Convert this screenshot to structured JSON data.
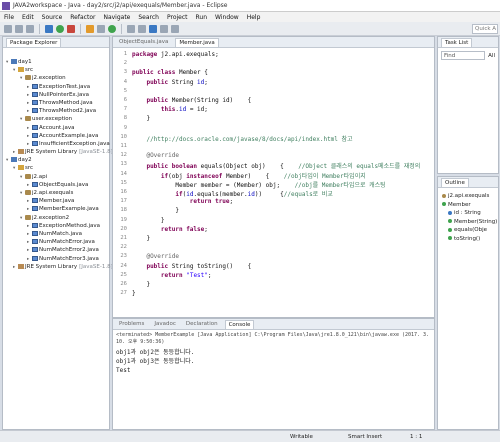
{
  "window": {
    "title": "JAVA2workspace - Java - day2/src/j2/api/exequals/Member.java - Eclipse"
  },
  "menu": [
    "File",
    "Edit",
    "Source",
    "Refactor",
    "Navigate",
    "Search",
    "Project",
    "Run",
    "Window",
    "Help"
  ],
  "quick_access": "Quick A",
  "package_explorer": {
    "tab": "Package Explorer",
    "items": [
      {
        "label": "day1",
        "kind": "proj",
        "indent": 0,
        "tri": "▾"
      },
      {
        "label": "src",
        "kind": "src",
        "indent": 1,
        "tri": "▾"
      },
      {
        "label": "j2.exception",
        "kind": "pkg",
        "indent": 2,
        "tri": "▾"
      },
      {
        "label": "ExceptionTest.java",
        "kind": "java",
        "indent": 3,
        "tri": "▸"
      },
      {
        "label": "NullPointerEx.java",
        "kind": "java",
        "indent": 3,
        "tri": "▸"
      },
      {
        "label": "ThrowsMethod.java",
        "kind": "java",
        "indent": 3,
        "tri": "▸"
      },
      {
        "label": "ThrowsMethod2.java",
        "kind": "java",
        "indent": 3,
        "tri": "▸"
      },
      {
        "label": "user.exception",
        "kind": "pkg",
        "indent": 2,
        "tri": "▾"
      },
      {
        "label": "Account.java",
        "kind": "java",
        "indent": 3,
        "tri": "▸"
      },
      {
        "label": "AccountExample.java",
        "kind": "java",
        "indent": 3,
        "tri": "▸"
      },
      {
        "label": "InsufficientException.java",
        "kind": "java",
        "indent": 3,
        "tri": "▸"
      },
      {
        "label": "JRE System Library",
        "suffix": "[JavaSE-1.8]",
        "kind": "lib",
        "indent": 1,
        "tri": "▸"
      },
      {
        "label": "day2",
        "kind": "proj",
        "indent": 0,
        "tri": "▾"
      },
      {
        "label": "src",
        "kind": "src",
        "indent": 1,
        "tri": "▾"
      },
      {
        "label": "j2.api",
        "kind": "pkg",
        "indent": 2,
        "tri": "▾"
      },
      {
        "label": "ObjectEquals.java",
        "kind": "java",
        "indent": 3,
        "tri": "▸"
      },
      {
        "label": "j2.api.exequals",
        "kind": "pkg",
        "indent": 2,
        "tri": "▾"
      },
      {
        "label": "Member.java",
        "kind": "java",
        "indent": 3,
        "tri": "▸"
      },
      {
        "label": "MemberExample.java",
        "kind": "java",
        "indent": 3,
        "tri": "▸"
      },
      {
        "label": "j2.exception2",
        "kind": "pkg",
        "indent": 2,
        "tri": "▾"
      },
      {
        "label": "ExceptionMethod.java",
        "kind": "java",
        "indent": 3,
        "tri": "▸"
      },
      {
        "label": "NumMatch.java",
        "kind": "java",
        "indent": 3,
        "tri": "▸"
      },
      {
        "label": "NumMatchError.java",
        "kind": "java",
        "indent": 3,
        "tri": "▸"
      },
      {
        "label": "NumMatchError2.java",
        "kind": "java",
        "indent": 3,
        "tri": "▸"
      },
      {
        "label": "NumMatchError3.java",
        "kind": "java",
        "indent": 3,
        "tri": "▸"
      },
      {
        "label": "JRE System Library",
        "suffix": "[JavaSE-1.8]",
        "kind": "lib",
        "indent": 1,
        "tri": "▸"
      }
    ]
  },
  "editor": {
    "tabs": [
      {
        "label": "ObjectEquals.java",
        "active": false
      },
      {
        "label": "Member.java",
        "active": true
      }
    ],
    "lines": [
      {
        "n": "1",
        "html": "<span class=\"kw\">package</span> j2.api.exequals;"
      },
      {
        "n": "2",
        "html": ""
      },
      {
        "n": "3",
        "html": "<span class=\"kw\">public class</span> Member {"
      },
      {
        "n": "4",
        "html": "    <span class=\"kw\">public</span> String <span class=\"fld\">id</span>;"
      },
      {
        "n": "5",
        "html": ""
      },
      {
        "n": "6",
        "html": "    <span class=\"kw\">public</span> Member(String id)    {"
      },
      {
        "n": "7",
        "html": "        <span class=\"kw\">this</span>.<span class=\"fld\">id</span> = id;"
      },
      {
        "n": "8",
        "html": "    }"
      },
      {
        "n": "9",
        "html": ""
      },
      {
        "n": "10",
        "html": "    <span class=\"cm\">//http://docs.oracle.com/javase/8/docs/api/index.html 참고</span>"
      },
      {
        "n": "11",
        "html": ""
      },
      {
        "n": "12",
        "html": "    <span class=\"ann\">@Override</span>"
      },
      {
        "n": "13",
        "html": "    <span class=\"kw\">public boolean</span> equals(Object obj)    {    <span class=\"cm\">//Object 클래스의 equals메소드를 재정의</span>"
      },
      {
        "n": "14",
        "html": "        <span class=\"kw\">if</span>(obj <span class=\"kw\">instanceof</span> Member)    {    <span class=\"cm\">//obj타입이 Member타입이지</span>"
      },
      {
        "n": "15",
        "html": "            Member member = (Member) obj;    <span class=\"cm\">//obj를 Member타입으로 캐스팅</span>"
      },
      {
        "n": "16",
        "html": "            <span class=\"kw\">if</span>(<span class=\"fld\">id</span>.equals(member.<span class=\"fld\">id</span>))     {<span class=\"cm\">//equals로 비교</span>"
      },
      {
        "n": "17",
        "html": "                <span class=\"kw\">return true</span>;"
      },
      {
        "n": "18",
        "html": "            }"
      },
      {
        "n": "19",
        "html": "        }"
      },
      {
        "n": "20",
        "html": "        <span class=\"kw\">return false</span>;"
      },
      {
        "n": "21",
        "html": "    }"
      },
      {
        "n": "22",
        "html": ""
      },
      {
        "n": "23",
        "html": "    <span class=\"ann\">@Override</span>"
      },
      {
        "n": "24",
        "html": "    <span class=\"kw\">public</span> String toString()    {"
      },
      {
        "n": "25",
        "html": "        <span class=\"kw\">return</span> <span class=\"str\">\"Test\"</span>;"
      },
      {
        "n": "26",
        "html": "    }"
      },
      {
        "n": "27",
        "html": "}"
      }
    ]
  },
  "bottom_tabs": [
    "Problems",
    "Javadoc",
    "Declaration",
    "Console"
  ],
  "console": {
    "header": "<terminated> MemberExample [Java Application] C:\\Program Files\\Java\\jre1.8.0_121\\bin\\javaw.exe (2017. 3. 10. 오후 9:50:36)",
    "lines": [
      "obj1과 obj2은 동등합니다.",
      "obj1과 obj3은 동등합니다.",
      "Test"
    ]
  },
  "task_list": {
    "tab": "Task List",
    "find": "Find",
    "all": "All"
  },
  "outline": {
    "tab": "Outline",
    "items": [
      {
        "label": "j2.api.exequals",
        "indent": 0,
        "color": "#a9894c"
      },
      {
        "label": "Member",
        "indent": 0,
        "color": "#3fa34d"
      },
      {
        "label": "id : String",
        "indent": 1,
        "color": "#3a78c3"
      },
      {
        "label": "Member(String)",
        "indent": 1,
        "color": "#3fa34d"
      },
      {
        "label": "equals(Obje",
        "indent": 1,
        "color": "#3fa34d"
      },
      {
        "label": "toString()",
        "indent": 1,
        "color": "#3fa34d"
      }
    ]
  },
  "status": {
    "writable": "Writable",
    "insert": "Smart Insert",
    "pos": "1 : 1"
  }
}
